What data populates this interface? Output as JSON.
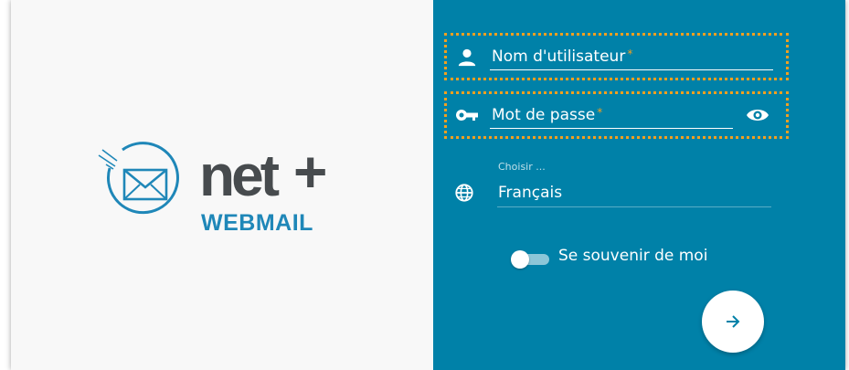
{
  "logo": {
    "brand": "net",
    "plus": "+",
    "subtitle": "WEBMAIL"
  },
  "form": {
    "username": {
      "label": "Nom d'utilisateur",
      "required_mark": "*",
      "icon": "user-icon"
    },
    "password": {
      "label": "Mot de passe",
      "required_mark": "*",
      "icon": "key-icon",
      "toggle_icon": "eye-icon"
    },
    "language": {
      "label": "Choisir ...",
      "value": "Français",
      "icon": "globe-icon"
    },
    "remember": {
      "label": "Se souvenir de moi",
      "checked": false
    },
    "submit": {
      "icon": "arrow-right-icon"
    }
  },
  "colors": {
    "panel_blue": "#0081a8",
    "left_bg": "#f8f8f8",
    "brand_dark": "#474b4e",
    "brand_blue": "#1f87b8",
    "highlight": "#f0a020"
  }
}
